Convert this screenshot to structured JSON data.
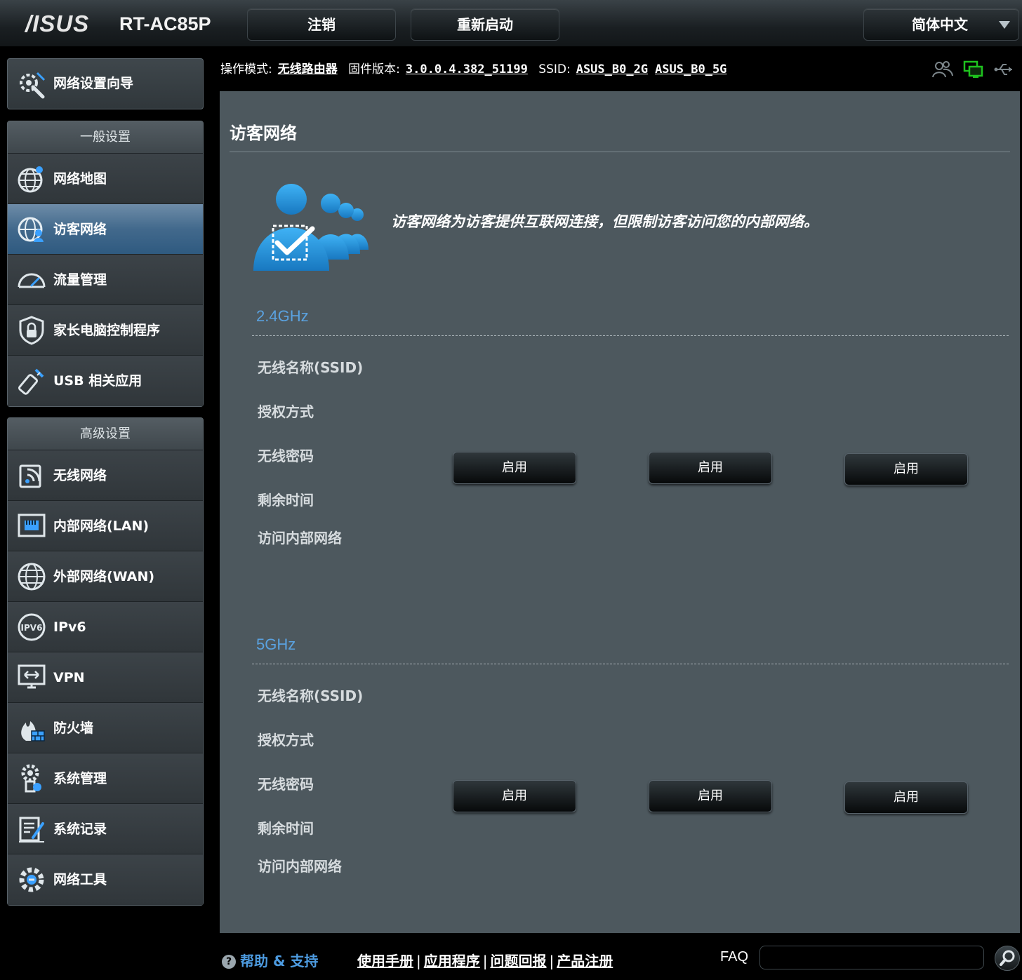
{
  "header": {
    "logo": "/ISUS",
    "model": "RT-AC85P",
    "logout_label": "注销",
    "reboot_label": "重新启动",
    "language": "简体中文"
  },
  "infobar": {
    "mode_label": "操作模式:",
    "mode_value": "无线路由器",
    "firmware_label": "固件版本:",
    "firmware_value": "3.0.0.4.382_51199",
    "ssid_label": "SSID:",
    "ssid_2g": "ASUS_B0_2G",
    "ssid_5g": "ASUS_B0_5G"
  },
  "sidebar": {
    "wizard_label": "网络设置向导",
    "general_header": "一般设置",
    "general_items": [
      {
        "label": "网络地图",
        "icon": "globe-network-icon"
      },
      {
        "label": "访客网络",
        "icon": "guest-globe-icon"
      },
      {
        "label": "流量管理",
        "icon": "speedometer-icon"
      },
      {
        "label": "家长电脑控制程序",
        "icon": "parental-lock-icon"
      },
      {
        "label": "USB 相关应用",
        "icon": "usb-icon"
      }
    ],
    "advanced_header": "高级设置",
    "advanced_items": [
      {
        "label": "无线网络",
        "icon": "wireless-icon"
      },
      {
        "label": "内部网络(LAN)",
        "icon": "lan-icon"
      },
      {
        "label": "外部网络(WAN)",
        "icon": "wan-globe-icon"
      },
      {
        "label": "IPv6",
        "icon": "ipv6-icon"
      },
      {
        "label": "VPN",
        "icon": "vpn-icon"
      },
      {
        "label": "防火墙",
        "icon": "firewall-icon"
      },
      {
        "label": "系统管理",
        "icon": "system-admin-icon"
      },
      {
        "label": "系统记录",
        "icon": "system-log-icon"
      },
      {
        "label": "网络工具",
        "icon": "network-tools-icon"
      }
    ]
  },
  "main": {
    "title": "访客网络",
    "description": "访客网络为访客提供互联网连接，但限制访客访问您的内部网络。",
    "bands": [
      {
        "name": "2.4GHz",
        "rows": [
          "无线名称(SSID)",
          "授权方式",
          "无线密码",
          "剩余时间",
          "访问内部网络"
        ],
        "buttons": [
          "启用",
          "启用",
          "启用"
        ]
      },
      {
        "name": "5GHz",
        "rows": [
          "无线名称(SSID)",
          "授权方式",
          "无线密码",
          "剩余时间",
          "访问内部网络"
        ],
        "buttons": [
          "启用",
          "启用",
          "启用"
        ]
      }
    ]
  },
  "footer": {
    "help": "帮助 & 支持",
    "links": [
      "使用手册",
      "应用程序",
      "问题回报",
      "产品注册"
    ],
    "faq_label": "FAQ",
    "faq_placeholder": ""
  },
  "colors": {
    "accent_blue": "#5aa2e0",
    "panel_bg": "#4d585e",
    "active_nav": "#42698c"
  }
}
